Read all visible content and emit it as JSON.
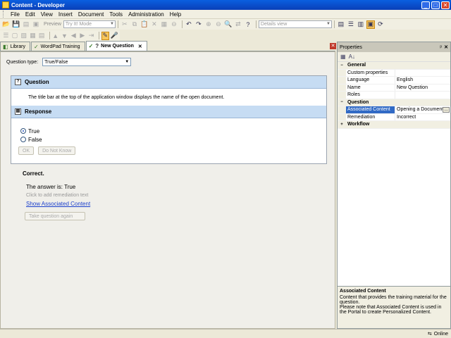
{
  "window": {
    "title": "Content - Developer"
  },
  "menu": [
    "File",
    "Edit",
    "View",
    "Insert",
    "Document",
    "Tools",
    "Administration",
    "Help"
  ],
  "toolbar": {
    "preview_label": "Preview",
    "mode_select": "Try It! Mode",
    "view_select": "Details view"
  },
  "tabs": [
    {
      "label": "Library",
      "icon": "library-icon"
    },
    {
      "label": "WordPad Training",
      "icon": "check-icon"
    },
    {
      "label": "New Question",
      "icon": "question-icon",
      "close": "✕"
    }
  ],
  "editor": {
    "question_type_label": "Question type:",
    "question_type_value": "True/False",
    "question_header": "Question",
    "question_text": "The title bar at the top of the application window displays the name of the open document.",
    "response_header": "Response",
    "options": [
      {
        "label": "True",
        "selected": true
      },
      {
        "label": "False",
        "selected": false
      }
    ],
    "ok_button": "OK",
    "do_not_know_button": "Do Not Know",
    "result_title": "Correct.",
    "answer_line": "The answer is: True",
    "remediation_hint": "Click to add remediation text",
    "show_associated_link": "Show Associated Content",
    "take_again_button": "Take question again"
  },
  "properties": {
    "title": "Properties",
    "pin": "ᵖ",
    "close": "✕",
    "sort_label": "A↓",
    "rows": [
      {
        "type": "cat",
        "key": "General",
        "exp": "−"
      },
      {
        "type": "row",
        "key": "Custom properties",
        "value": ""
      },
      {
        "type": "row",
        "key": "Language",
        "value": "English"
      },
      {
        "type": "row",
        "key": "Name",
        "value": "New Question"
      },
      {
        "type": "row",
        "key": "Roles",
        "value": ""
      },
      {
        "type": "cat",
        "key": "Question",
        "exp": "−"
      },
      {
        "type": "sel",
        "key": "Associated Content",
        "value": "Opening a Document"
      },
      {
        "type": "row",
        "key": "Remediation",
        "value": "Incorrect"
      },
      {
        "type": "cat",
        "key": "Workflow",
        "exp": "+"
      }
    ],
    "description_title": "Associated Content",
    "description_text": "Content that provides the training material for the question.\nPlease note that Associated Content is used in the Portal to create Personalized Content."
  },
  "status": {
    "text": "Online"
  }
}
